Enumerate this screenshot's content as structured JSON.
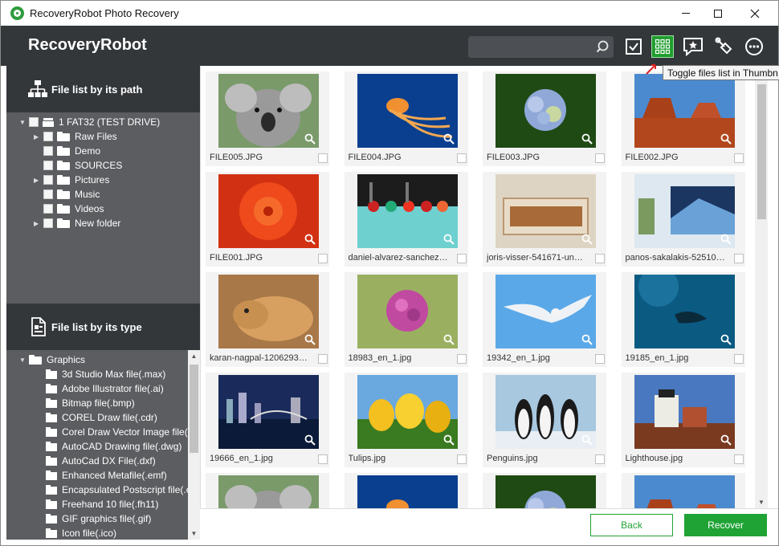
{
  "window": {
    "title": "RecoveryRobot Photo Recovery",
    "controls": [
      "minimize",
      "maximize",
      "close"
    ]
  },
  "header": {
    "brand": "RecoveryRobot",
    "search": {
      "placeholder": "",
      "value": ""
    },
    "toolbar": [
      {
        "name": "select-all",
        "icon": "checkbox-icon"
      },
      {
        "name": "thumbnail-view",
        "icon": "grid-icon",
        "active": true,
        "color": "#1f9d2e"
      },
      {
        "name": "feedback",
        "icon": "comment-star-icon"
      },
      {
        "name": "tools",
        "icon": "tools-icon"
      },
      {
        "name": "more",
        "icon": "more-icon"
      }
    ],
    "tooltip": "Toggle files list in Thumbn"
  },
  "left_panel": {
    "path_section": {
      "title": "File list by its path",
      "tree": [
        {
          "label": "1 FAT32 (TEST DRIVE)",
          "expanded": true,
          "type": "drive"
        },
        {
          "label": "Raw Files",
          "expandable": true,
          "type": "folder"
        },
        {
          "label": "Demo",
          "expandable": false,
          "type": "folder"
        },
        {
          "label": "SOURCES",
          "expandable": false,
          "type": "folder"
        },
        {
          "label": "Pictures",
          "expandable": true,
          "type": "folder"
        },
        {
          "label": "Music",
          "expandable": false,
          "type": "folder"
        },
        {
          "label": "Videos",
          "expandable": false,
          "type": "folder"
        },
        {
          "label": "New folder",
          "expandable": true,
          "type": "folder"
        }
      ]
    },
    "type_section": {
      "title": "File list by its type",
      "root": "Graphics",
      "items": [
        "3d Studio Max file(.max)",
        "Adobe Illustrator file(.ai)",
        "Bitmap file(.bmp)",
        "COREL Draw file(.cdr)",
        "Corel Draw Vector Image file(",
        "AutoCAD Drawing file(.dwg)",
        "AutoCad DX File(.dxf)",
        "Enhanced Metafile(.emf)",
        "Encapsulated Postscript file(.e",
        "Freehand 10 file(.fh11)",
        "GIF graphics file(.gif)",
        "Icon file(.ico)"
      ]
    }
  },
  "files": [
    {
      "name": "FILE005.JPG",
      "thumb": "koala"
    },
    {
      "name": "FILE004.JPG",
      "thumb": "jellyfish"
    },
    {
      "name": "FILE003.JPG",
      "thumb": "hydrangea"
    },
    {
      "name": "FILE002.JPG",
      "thumb": "desert"
    },
    {
      "name": "FILE001.JPG",
      "thumb": "chrysanthemum"
    },
    {
      "name": "daniel-alvarez-sanchez-d...",
      "thumb": "bowling"
    },
    {
      "name": "joris-visser-541671-unsp...",
      "thumb": "cigar-box"
    },
    {
      "name": "panos-sakalakis-525108-...",
      "thumb": "window-laptop"
    },
    {
      "name": "karan-nagpal-1206293-u...",
      "thumb": "dog"
    },
    {
      "name": "18983_en_1.jpg",
      "thumb": "purple-flower"
    },
    {
      "name": "19342_en_1.jpg",
      "thumb": "seagull"
    },
    {
      "name": "19185_en_1.jpg",
      "thumb": "dolphin"
    },
    {
      "name": "19666_en_1.jpg",
      "thumb": "city-night"
    },
    {
      "name": "Tulips.jpg",
      "thumb": "tulips"
    },
    {
      "name": "Penguins.jpg",
      "thumb": "penguins"
    },
    {
      "name": "Lighthouse.jpg",
      "thumb": "lighthouse"
    },
    {
      "name": "",
      "thumb": "koala"
    },
    {
      "name": "",
      "thumb": "jellyfish"
    },
    {
      "name": "",
      "thumb": "hydrangea"
    },
    {
      "name": "",
      "thumb": "desert"
    }
  ],
  "footer": {
    "back_label": "Back",
    "recover_label": "Recover",
    "accent": "#1fa335"
  }
}
